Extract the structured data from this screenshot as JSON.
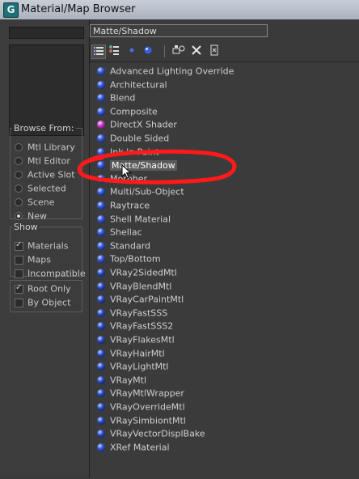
{
  "window": {
    "title": "Material/Map Browser",
    "app_icon_glyph": "G"
  },
  "left": {
    "browse_from": {
      "legend": "Browse From:",
      "options": [
        {
          "label": "Mtl Library",
          "selected": false
        },
        {
          "label": "Mtl Editor",
          "selected": false
        },
        {
          "label": "Active Slot",
          "selected": false
        },
        {
          "label": "Selected",
          "selected": false
        },
        {
          "label": "Scene",
          "selected": false
        },
        {
          "label": "New",
          "selected": true
        }
      ]
    },
    "show": {
      "legend": "Show",
      "options": [
        {
          "label": "Materials",
          "checked": true
        },
        {
          "label": "Maps",
          "checked": false
        },
        {
          "label": "Incompatible",
          "checked": false
        }
      ]
    },
    "extra": {
      "options": [
        {
          "label": "Root Only",
          "checked": true
        },
        {
          "label": "By Object",
          "checked": false
        }
      ]
    }
  },
  "right": {
    "filter_value": "Matte/Shadow",
    "toolbar": {
      "icons": [
        "view-list-icon",
        "view-list-icons-icon",
        "small-icons-icon",
        "large-icons-icon",
        "update-scene-icon",
        "delete-icon",
        "clear-library-icon"
      ]
    },
    "list": [
      {
        "label": "Advanced Lighting Override",
        "icon": "blue"
      },
      {
        "label": "Architectural",
        "icon": "blue"
      },
      {
        "label": "Blend",
        "icon": "blue"
      },
      {
        "label": "Composite",
        "icon": "blue"
      },
      {
        "label": "DirectX Shader",
        "icon": "pink"
      },
      {
        "label": "Double Sided",
        "icon": "blue"
      },
      {
        "label": "Ink 'n Paint",
        "icon": "blue"
      },
      {
        "label": "Matte/Shadow",
        "icon": "blue",
        "selected": true
      },
      {
        "label": "Morpher",
        "icon": "blue"
      },
      {
        "label": "Multi/Sub-Object",
        "icon": "blue"
      },
      {
        "label": "Raytrace",
        "icon": "blue"
      },
      {
        "label": "Shell Material",
        "icon": "blue"
      },
      {
        "label": "Shellac",
        "icon": "blue"
      },
      {
        "label": "Standard",
        "icon": "blue"
      },
      {
        "label": "Top/Bottom",
        "icon": "blue"
      },
      {
        "label": "VRay2SidedMtl",
        "icon": "dark"
      },
      {
        "label": "VRayBlendMtl",
        "icon": "dark"
      },
      {
        "label": "VRayCarPaintMtl",
        "icon": "dark"
      },
      {
        "label": "VRayFastSSS",
        "icon": "dark"
      },
      {
        "label": "VRayFastSSS2",
        "icon": "dark"
      },
      {
        "label": "VRayFlakesMtl",
        "icon": "dark"
      },
      {
        "label": "VRayHairMtl",
        "icon": "dark"
      },
      {
        "label": "VRayLightMtl",
        "icon": "dark"
      },
      {
        "label": "VRayMtl",
        "icon": "dark"
      },
      {
        "label": "VRayMtlWrapper",
        "icon": "dark"
      },
      {
        "label": "VRayOverrideMtl",
        "icon": "dark"
      },
      {
        "label": "VRaySimbiontMtl",
        "icon": "dark"
      },
      {
        "label": "VRayVectorDisplBake",
        "icon": "dark"
      },
      {
        "label": "XRef Material",
        "icon": "blue"
      }
    ]
  },
  "colors": {
    "annotation_red": "#ff1a1a",
    "selection_bg": "#5a5a5a"
  }
}
